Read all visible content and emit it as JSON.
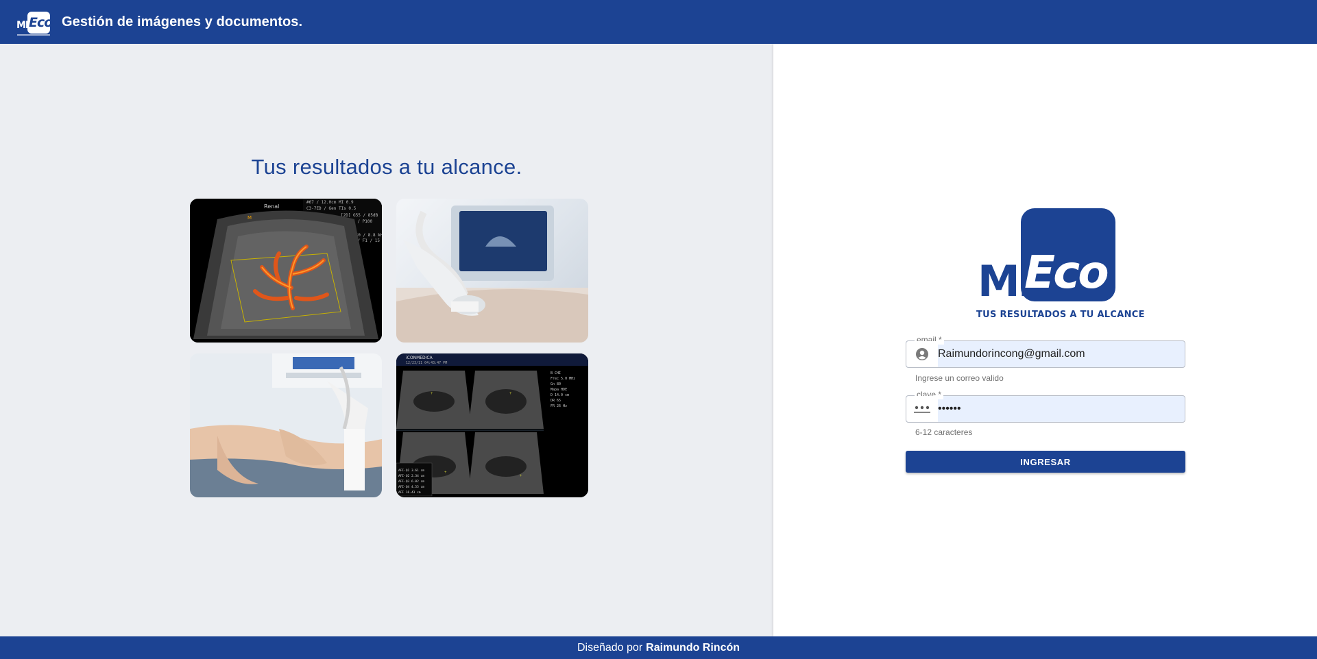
{
  "header": {
    "logo_mi": "MI",
    "logo_eco": "Eco",
    "title": "Gestión de imágenes y documentos."
  },
  "left": {
    "tagline": "Tus resultados a tu alcance.",
    "images": [
      {
        "name": "renal-doppler-ultrasound-image",
        "label_renal": "Renal"
      },
      {
        "name": "ultrasound-transducer-photo"
      },
      {
        "name": "leg-ultrasound-exam-photo"
      },
      {
        "name": "multi-panel-ultrasound-image",
        "label_brand": "iCONMEDICA"
      }
    ]
  },
  "login": {
    "logo_mi": "MI",
    "logo_eco": "Eco",
    "logo_tagline": "TUS RESULTADOS A TU ALCANCE",
    "email": {
      "label": "email *",
      "value": "Raimundorincong@gmail.com",
      "hint": "Ingrese un correo valido",
      "icon": "account-circle-icon"
    },
    "password": {
      "label": "clave *",
      "value": "••••••",
      "hint": "6-12 caracteres",
      "icon": "password-dots-icon"
    },
    "submit_label": "INGRESAR"
  },
  "footer": {
    "prefix": "Diseñado por",
    "author": "Raimundo Rincón"
  },
  "colors": {
    "brand_blue": "#1c4393",
    "left_bg": "#eceef2",
    "input_fill": "#e8f0fe"
  }
}
